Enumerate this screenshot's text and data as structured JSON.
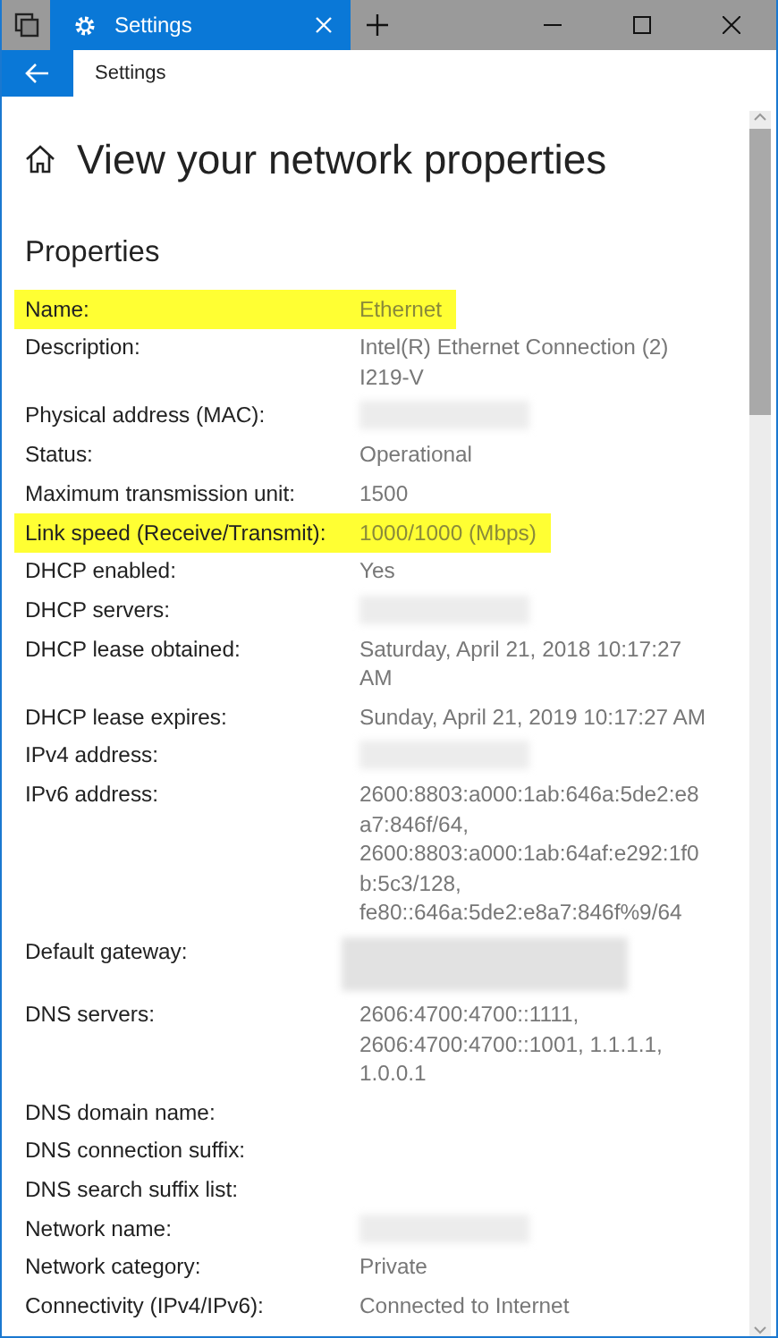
{
  "window": {
    "tab_title": "Settings"
  },
  "nav": {
    "title": "Settings"
  },
  "page": {
    "title": "View your network properties",
    "section": "Properties"
  },
  "properties": [
    {
      "label": "Name:",
      "kind": "text",
      "value": "Ethernet",
      "highlighted": true
    },
    {
      "label": "Description:",
      "kind": "text",
      "value": "Intel(R) Ethernet Connection (2) I219-V",
      "highlighted": false
    },
    {
      "label": "Physical address (MAC):",
      "kind": "blurred",
      "highlighted": false
    },
    {
      "label": "Status:",
      "kind": "text",
      "value": "Operational",
      "highlighted": false
    },
    {
      "label": "Maximum transmission unit:",
      "kind": "text",
      "value": "1500",
      "highlighted": false
    },
    {
      "label": "Link speed (Receive/Transmit):",
      "kind": "text",
      "value": "1000/1000 (Mbps)",
      "highlighted": true
    },
    {
      "label": "DHCP enabled:",
      "kind": "text",
      "value": "Yes",
      "highlighted": false
    },
    {
      "label": "DHCP servers:",
      "kind": "blurred",
      "highlighted": false
    },
    {
      "label": "DHCP lease obtained:",
      "kind": "text",
      "value": "Saturday, April 21, 2018 10:17:27 AM",
      "highlighted": false
    },
    {
      "label": "DHCP lease expires:",
      "kind": "text",
      "value": "Sunday, April 21, 2019 10:17:27 AM",
      "highlighted": false
    },
    {
      "label": "IPv4 address:",
      "kind": "blurred",
      "highlighted": false
    },
    {
      "label": "IPv6 address:",
      "kind": "text",
      "value": "2600:8803:a000:1ab:646a:5de2:e8a7:846f/64, 2600:8803:a000:1ab:64af:e292:1f0b:5c3/128, fe80::646a:5de2:e8a7:846f%9/64",
      "highlighted": false
    },
    {
      "label": "Default gateway:",
      "kind": "blurred-large",
      "highlighted": false
    },
    {
      "label": "DNS servers:",
      "kind": "text",
      "value": "2606:4700:4700::1111, 2606:4700:4700::1001, 1.1.1.1, 1.0.0.1",
      "highlighted": false
    },
    {
      "label": "DNS domain name:",
      "kind": "empty",
      "highlighted": false
    },
    {
      "label": "DNS connection suffix:",
      "kind": "empty",
      "highlighted": false
    },
    {
      "label": "DNS search suffix list:",
      "kind": "empty",
      "highlighted": false
    },
    {
      "label": "Network name:",
      "kind": "blurred",
      "highlighted": false
    },
    {
      "label": "Network category:",
      "kind": "text",
      "value": "Private",
      "highlighted": false
    },
    {
      "label": "Connectivity (IPv4/IPv6):",
      "kind": "text",
      "value": "Connected to Internet",
      "highlighted": false
    }
  ]
}
